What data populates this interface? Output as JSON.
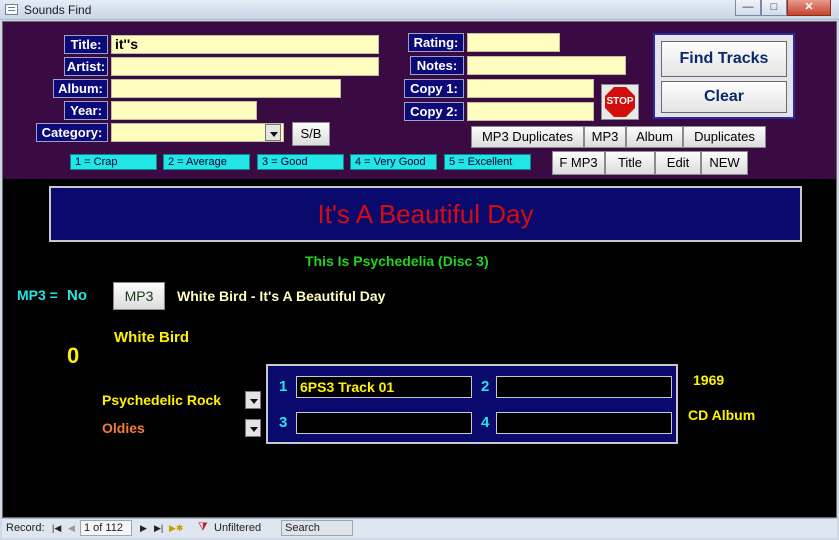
{
  "window": {
    "title": "Sounds Find",
    "min": "—",
    "max": "□",
    "close": "✕"
  },
  "filters": {
    "title_label": "Title:",
    "title_value": "it''s",
    "artist_label": "Artist:",
    "artist_value": "",
    "album_label": "Album:",
    "album_value": "",
    "year_label": "Year:",
    "year_value": "",
    "category_label": "Category:",
    "category_value": "",
    "rating_label": "Rating:",
    "rating_value": "",
    "notes_label": "Notes:",
    "notes_value": "",
    "copy1_label": "Copy 1:",
    "copy1_value": "",
    "copy2_label": "Copy 2:",
    "copy2_value": ""
  },
  "buttons": {
    "sb": "S/B",
    "find": "Find Tracks",
    "clear": "Clear",
    "stop": "STOP",
    "mp3dup": "MP3 Duplicates",
    "mp3": "MP3",
    "album": "Album",
    "duplicates": "Duplicates",
    "fmp3": "F MP3",
    "title": "Title",
    "edit": "Edit",
    "new": "NEW"
  },
  "ratings": [
    "1 = Crap",
    "2 = Average",
    "3 = Good",
    "4 = Very Good",
    "5 = Excellent"
  ],
  "record": {
    "artist": "It's A Beautiful Day",
    "album": "This Is Psychedelia (Disc 3)",
    "mp3_label": "MP3 =",
    "mp3_value": "No",
    "mp3_button": "MP3",
    "track_full": "White Bird - It's A Beautiful Day",
    "track_title": "White Bird",
    "rating": "0",
    "genre1": "Psychedelic Rock",
    "genre2": "Oldies",
    "year": "1969",
    "format": "CD Album",
    "copies": [
      {
        "n": "1",
        "v": "6PS3 Track 01"
      },
      {
        "n": "2",
        "v": ""
      },
      {
        "n": "3",
        "v": ""
      },
      {
        "n": "4",
        "v": ""
      }
    ]
  },
  "status": {
    "record_label": "Record:",
    "position": "1 of 112",
    "filter": "Unfiltered",
    "search": "Search"
  },
  "colors": {
    "header_bg": "#3a0a42",
    "label_bg": "#0c0a78",
    "input_bg": "#fffcbf",
    "rating_bg": "#22e6e6",
    "artist_text": "#d60c0c",
    "highlight": "#fff200"
  }
}
